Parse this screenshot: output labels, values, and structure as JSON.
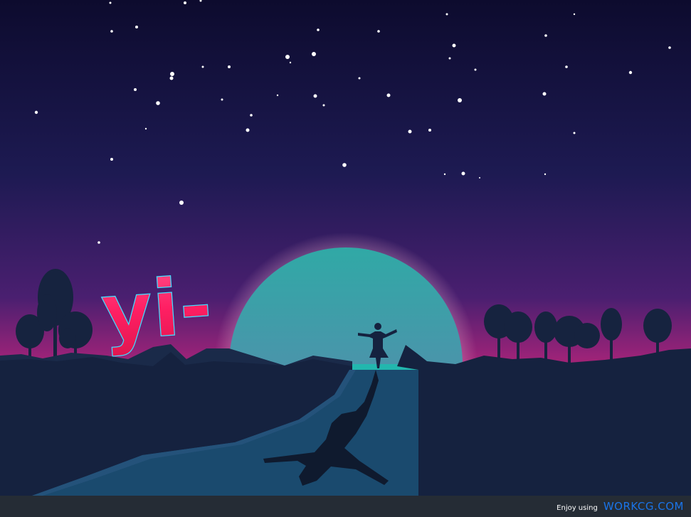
{
  "artwork": {
    "logo_text": "yi-",
    "palette": {
      "sky_top": "#0d0b2e",
      "sky_mid": "#3a1d66",
      "sky_horizon": "#c0246c",
      "moon_top": "#36a8a8",
      "moon_bottom": "#a59bb8",
      "land": "#15223f",
      "road": "#1a4a6e",
      "logo": "#ff2a6d"
    },
    "icons": [
      "stars",
      "moon",
      "tree-silhouettes",
      "girl-silhouette",
      "girl-shadow",
      "road"
    ]
  },
  "footer": {
    "enjoy_label": "Enjoy using",
    "site_label": "WORKCG.COM"
  }
}
